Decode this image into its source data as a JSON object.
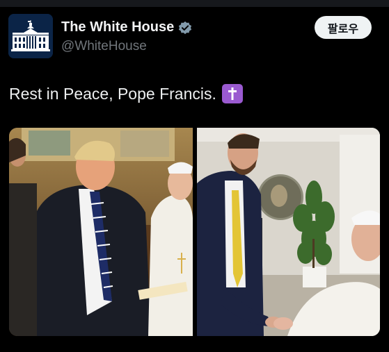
{
  "account": {
    "display_name": "The White House",
    "handle": "@WhiteHouse",
    "verified": true,
    "avatar_icon": "white-house-logo-icon"
  },
  "actions": {
    "follow_label": "팔로우"
  },
  "post": {
    "text": "Rest in Peace, Pope Francis.",
    "emoji_icon": "latin-cross-icon"
  },
  "media": {
    "photos": [
      {
        "icon": "photo-left-meeting"
      },
      {
        "icon": "photo-right-handshake"
      }
    ]
  },
  "colors": {
    "background": "#000000",
    "text_primary": "#e7e9ea",
    "text_secondary": "#71767b",
    "verified_badge": "#829aab",
    "follow_bg": "#eff3f4",
    "cross_emoji_bg": "#9a5ad0"
  }
}
